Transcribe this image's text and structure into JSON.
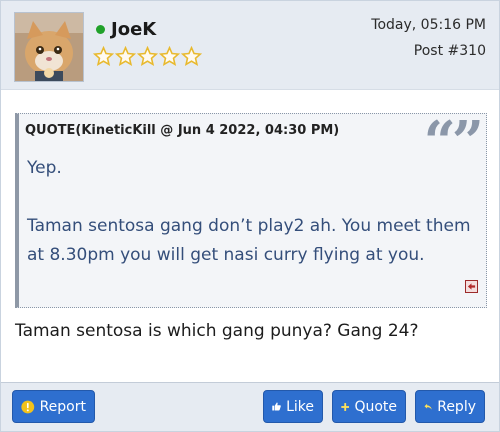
{
  "post": {
    "username": "JoeK",
    "date": "Today, 05:16 PM",
    "post_number": "Post #310",
    "rating_stars": 5,
    "online": true
  },
  "quote": {
    "title": "QUOTE(KineticKill @ Jun 4 2022, 04:30 PM)",
    "paragraphs": [
      "Yep.",
      "Taman sentosa gang don’t play2 ah. You meet them at 8.30pm you will get nasi curry flying at you."
    ]
  },
  "body": {
    "text": "Taman sentosa is which gang punya? Gang 24?"
  },
  "footer": {
    "report_label": "Report",
    "like_label": "Like",
    "quote_label": "Quote",
    "reply_label": "Reply"
  },
  "colors": {
    "accent": "#2e6fcf",
    "header_bg": "#e6ebf2",
    "online": "#20a12a",
    "star": "#e8b92e"
  }
}
